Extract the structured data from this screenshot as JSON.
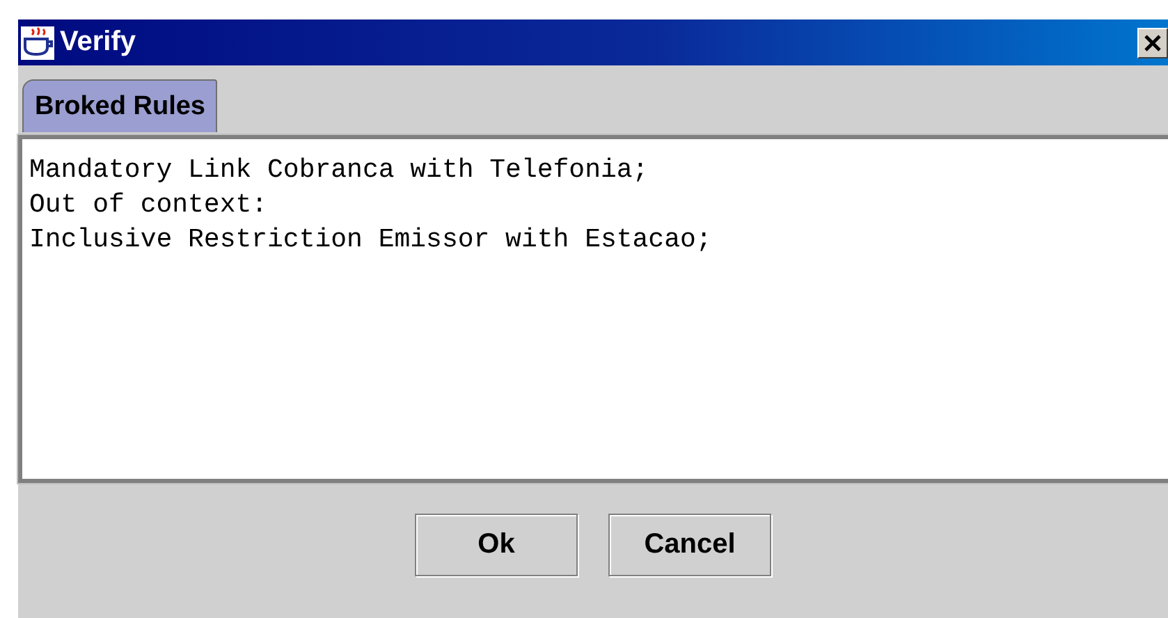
{
  "window": {
    "title": "Verify"
  },
  "tabs": [
    {
      "label": "Broked Rules",
      "selected": true
    }
  ],
  "text_area": {
    "lines": [
      "Mandatory Link Cobranca with Telefonia;",
      "Out of context:",
      "Inclusive Restriction Emissor with Estacao;"
    ]
  },
  "buttons": [
    "Ok",
    "Cancel"
  ]
}
